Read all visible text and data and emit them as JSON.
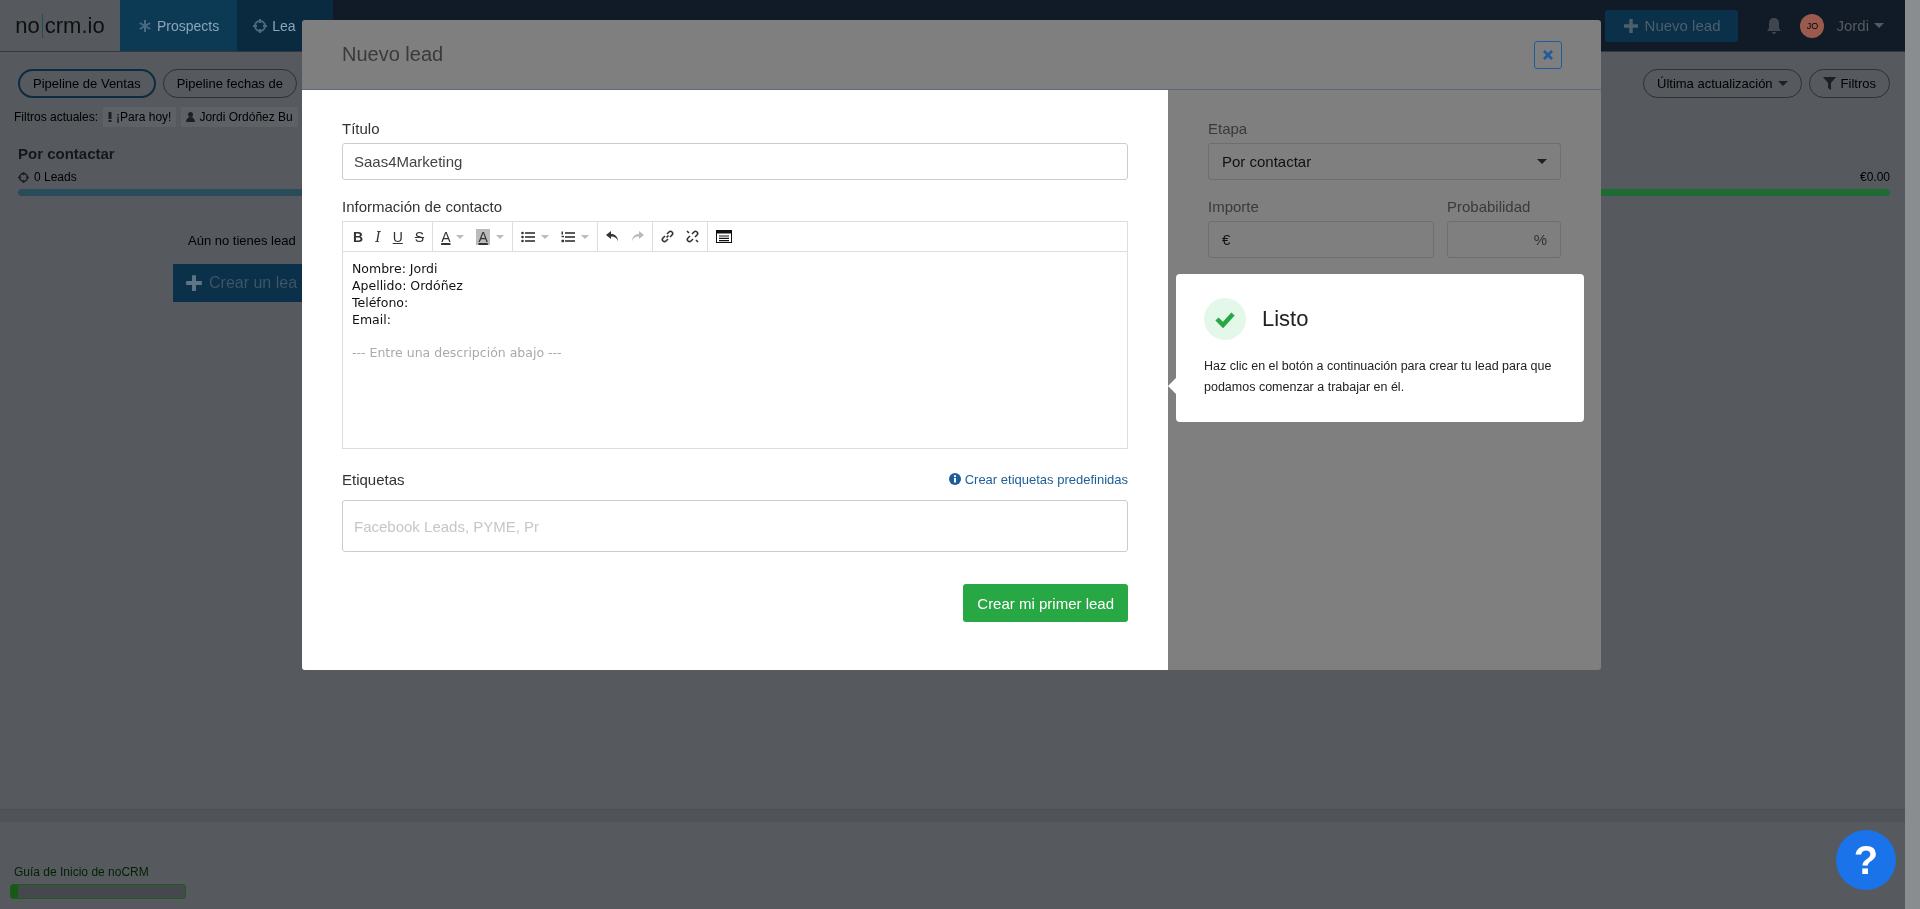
{
  "logo": [
    "no",
    "crm.io"
  ],
  "nav": [
    {
      "label": "Prospects",
      "selected": false
    },
    {
      "label": "Lea",
      "selected": true
    }
  ],
  "new_lead_button": "Nuevo lead",
  "user": {
    "initials": "JO",
    "name": "Jordi"
  },
  "pipelines": [
    {
      "label": "Pipeline de Ventas",
      "selected": true
    },
    {
      "label": "Pipeline fechas de",
      "selected": false
    }
  ],
  "sort_button": "Última actualización",
  "filters_button": "Filtros",
  "current_filters": {
    "label": "Filtros actuales:",
    "items": [
      {
        "kind": "priority",
        "label": "¡Para hoy!"
      },
      {
        "kind": "user",
        "label": "Jordi Ordóñez Bu"
      }
    ]
  },
  "column": {
    "title": "Por contactar",
    "count": "0 Leads",
    "amount": "€0.00",
    "empty_text": "Aún no tienes lead",
    "create_button": "Crear un lea"
  },
  "guide": {
    "label": "Guía de Inicio de noCRM",
    "level": 0.04
  },
  "help_button": "?",
  "modal": {
    "title": "Nuevo lead",
    "title_label": "Título",
    "title_value": "Saas4Marketing",
    "contact_label": "Información de contacto",
    "toolbar": [
      {
        "kind": "bold",
        "glyph": "B"
      },
      {
        "kind": "italic",
        "glyph": "I"
      },
      {
        "kind": "underline",
        "glyph": "U"
      },
      {
        "kind": "strike",
        "glyph": "S"
      },
      {
        "kind": "font-color",
        "glyph": "A"
      },
      {
        "kind": "back-color",
        "glyph": "A"
      },
      {
        "kind": "bullet-list"
      },
      {
        "kind": "number-list"
      },
      {
        "kind": "undo"
      },
      {
        "kind": "redo"
      },
      {
        "kind": "link"
      },
      {
        "kind": "unlink"
      },
      {
        "kind": "table"
      }
    ],
    "contact_lines": [
      "Nombre: Jordi",
      "Apellido: Ordóñez",
      "Teléfono:",
      "Email:"
    ],
    "description_hint": "--- Entre una descripción abajo ---",
    "tags_label": "Etiquetas",
    "tags_link": "Crear etiquetas predefinidas",
    "tags_placeholder": "Facebook Leads, PYME, Pr",
    "submit_button": "Crear mi primer lead",
    "stage_label": "Etapa",
    "stage_value": "Por contactar",
    "amount_label": "Importe",
    "amount_prefix": "€",
    "probability_label": "Probabilidad",
    "probability_suffix": "%"
  },
  "tooltip": {
    "title": "Listo",
    "text": "Haz clic en el botón a continuación para crear tu lead para que podamos comenzar a trabajar en él."
  }
}
